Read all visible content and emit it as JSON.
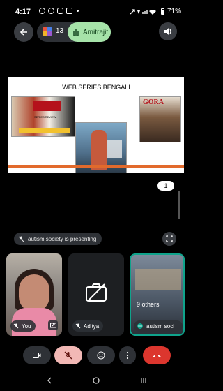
{
  "status_bar": {
    "time": "4:17",
    "battery": "71%",
    "app_icons": [
      "phone-icon",
      "whatsapp-icon",
      "instagram-icon",
      "linkedin-icon"
    ]
  },
  "call_header": {
    "participant_count": "13",
    "hand_raised_name": "Amitrajit"
  },
  "presentation": {
    "slide_title": "WEB SERIES BENGALI",
    "poster_texts": {
      "left_review": "SERIES REVIEW",
      "right_title": "GORA"
    },
    "page_indicator": "1",
    "presenting_label": "autism society is presenting"
  },
  "tiles": [
    {
      "name": "You"
    },
    {
      "name": "Aditya"
    },
    {
      "name": "autism soci",
      "overlay": "9 others"
    }
  ],
  "colors": {
    "accent_green": "#a6e3a9",
    "end_call_red": "#dc362e",
    "muted_pink": "#f2b8b5",
    "active_speaker_teal": "#0fa38b"
  }
}
